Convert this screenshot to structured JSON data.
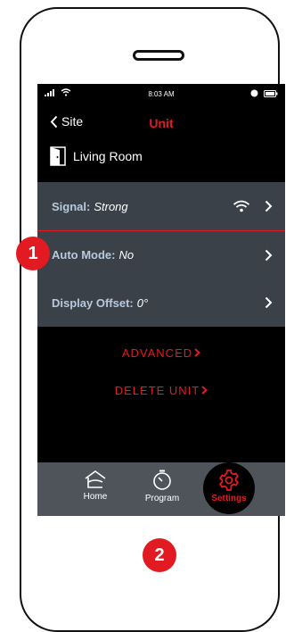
{
  "status_bar": {
    "time": "8:03 AM"
  },
  "nav": {
    "back_label": "Site",
    "title": "Unit"
  },
  "room": {
    "name": "Living Room"
  },
  "settings": [
    {
      "label": "Signal:",
      "value": "Strong"
    },
    {
      "label": "Auto Mode:",
      "value": "No"
    },
    {
      "label": "Display Offset:",
      "value": "0°"
    }
  ],
  "links": {
    "advanced": "ADVANCED",
    "delete_unit": "DELETE UNIT"
  },
  "tabs": [
    {
      "label": "Home"
    },
    {
      "label": "Program"
    },
    {
      "label": "Settings"
    }
  ],
  "badges": {
    "one": "1",
    "two": "2"
  },
  "colors": {
    "accent": "#e21a22",
    "list_bg": "#3a4149",
    "tabbar_bg": "#4f545b",
    "label_blue": "#b7c9dd"
  }
}
